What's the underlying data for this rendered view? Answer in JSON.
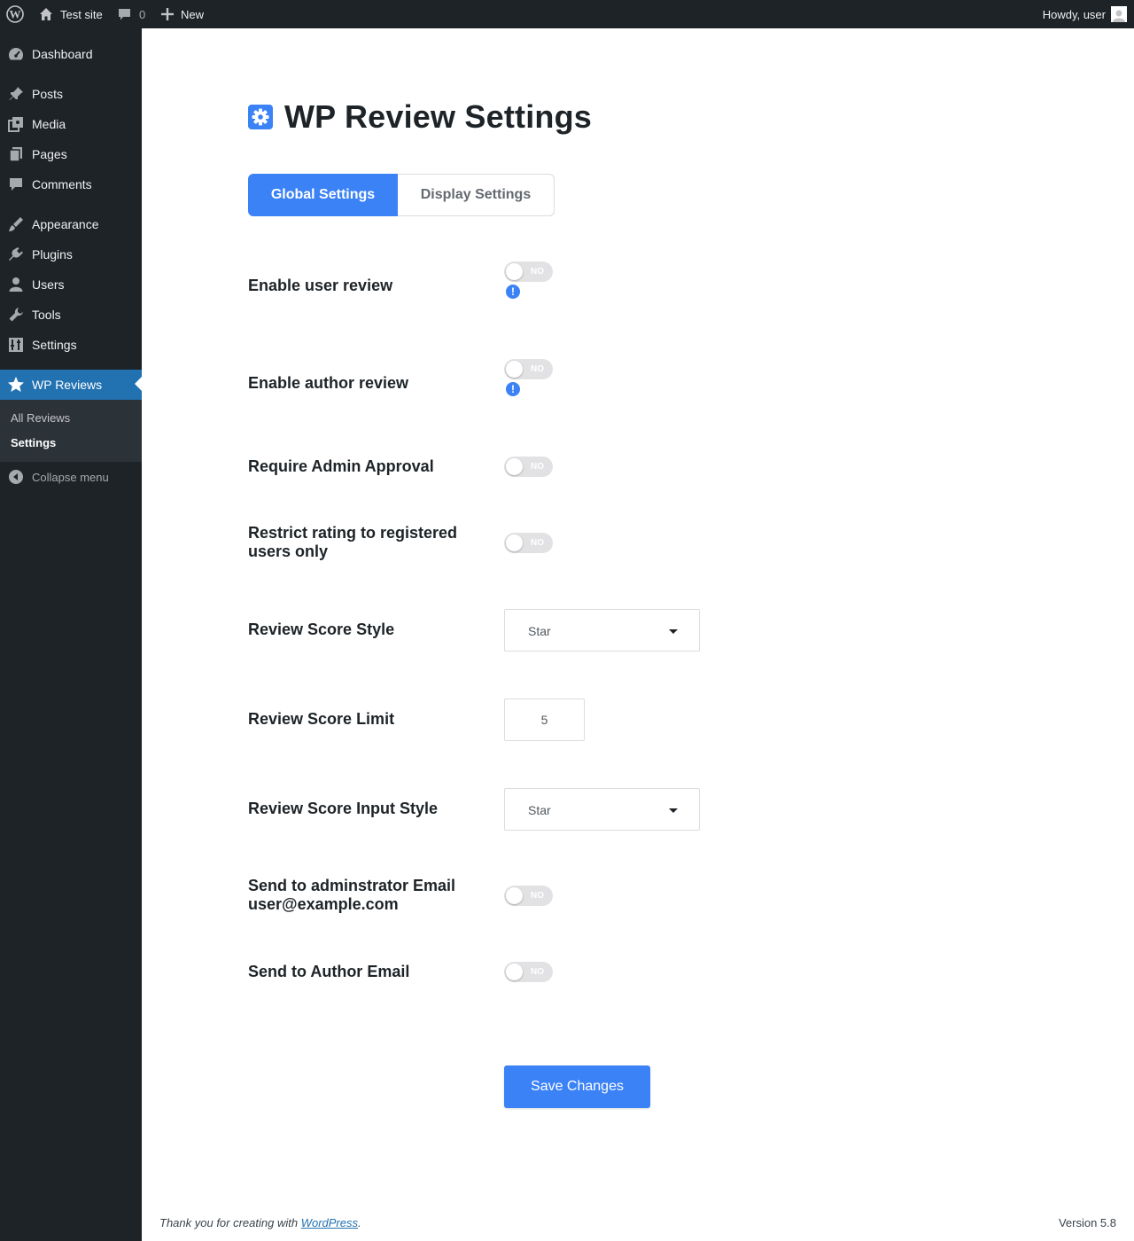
{
  "adminbar": {
    "site_name": "Test site",
    "comments_count": "0",
    "new_label": "New",
    "howdy": "Howdy, user"
  },
  "sidebar": {
    "items": [
      {
        "label": "Dashboard",
        "icon": "dashboard-icon"
      },
      {
        "label": "Posts",
        "icon": "pin-icon"
      },
      {
        "label": "Media",
        "icon": "media-icon"
      },
      {
        "label": "Pages",
        "icon": "pages-icon"
      },
      {
        "label": "Comments",
        "icon": "comment-icon"
      },
      {
        "label": "Appearance",
        "icon": "brush-icon"
      },
      {
        "label": "Plugins",
        "icon": "plugin-icon"
      },
      {
        "label": "Users",
        "icon": "user-icon"
      },
      {
        "label": "Tools",
        "icon": "wrench-icon"
      },
      {
        "label": "Settings",
        "icon": "settings-icon"
      },
      {
        "label": "WP Reviews",
        "icon": "star-icon"
      }
    ],
    "submenu": [
      {
        "label": "All Reviews"
      },
      {
        "label": "Settings"
      }
    ],
    "collapse_label": "Collapse menu"
  },
  "page": {
    "title": "WP Review Settings"
  },
  "tabs": [
    {
      "label": "Global Settings"
    },
    {
      "label": "Display Settings"
    }
  ],
  "settings": {
    "enable_user_review": {
      "label": "Enable user review",
      "toggle": "NO",
      "info": "!"
    },
    "enable_author_review": {
      "label": "Enable author review",
      "toggle": "NO",
      "info": "!"
    },
    "require_admin_approval": {
      "label": "Require Admin Approval",
      "toggle": "NO"
    },
    "restrict_rating": {
      "label": "Restrict rating to registered users only",
      "toggle": "NO"
    },
    "review_score_style": {
      "label": "Review Score Style",
      "value": "Star"
    },
    "review_score_limit": {
      "label": "Review Score Limit",
      "value": "5"
    },
    "review_score_input_style": {
      "label": "Review Score Input Style",
      "value": "Star"
    },
    "send_admin_email": {
      "label_line1": "Send to adminstrator Email",
      "label_line2": "user@example.com",
      "toggle": "NO"
    },
    "send_author_email": {
      "label": "Send to Author Email",
      "toggle": "NO"
    }
  },
  "save_label": "Save Changes",
  "footer": {
    "thanks_prefix": "Thank you for creating with ",
    "wordpress_link": "WordPress",
    "thanks_suffix": ".",
    "version": "Version 5.8"
  },
  "colors": {
    "accent": "#3b82f6",
    "admin_dark": "#1d2327",
    "wp_blue": "#2271b1"
  }
}
